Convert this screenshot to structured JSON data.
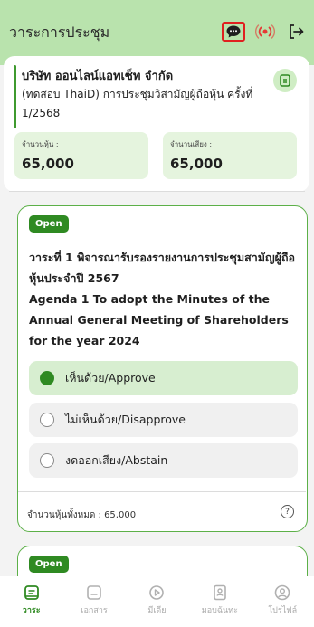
{
  "header": {
    "title": "วาระการประชุม"
  },
  "company": {
    "name": "บริษัท ออนไลน์แอทเซ็ท จำกัด",
    "meeting": "(ทดสอบ ThaiD) การประชุมวิสามัญผู้ถือหุ้น ครั้งที่ 1/2568"
  },
  "stats": {
    "shares_label": "จำนวนหุ้น :",
    "shares_value": "65,000",
    "votes_label": "จำนวนเสียง :",
    "votes_value": "65,000"
  },
  "agenda": {
    "status": "Open",
    "title_th": "วาระที่ 1 พิจารณารับรองรายงานการประชุมสามัญผู้ถือหุ้นประจำปี 2567",
    "title_en": "Agenda 1 To adopt the Minutes of the Annual General Meeting of Shareholders for the year 2024",
    "options": [
      {
        "label": "เห็นด้วย/Approve",
        "selected": true
      },
      {
        "label": "ไม่เห็นด้วย/Disapprove",
        "selected": false
      },
      {
        "label": "งดออกเสียง/Abstain",
        "selected": false
      }
    ],
    "total_label": "จำนวนหุ้นทั้งหมด : 65,000",
    "help_glyph": "?"
  },
  "agenda2": {
    "status": "Open"
  },
  "nav": {
    "items": [
      {
        "label": "วาระ",
        "icon": "agenda-icon",
        "active": true
      },
      {
        "label": "เอกสาร",
        "icon": "document-icon",
        "active": false
      },
      {
        "label": "มีเดีย",
        "icon": "media-icon",
        "active": false
      },
      {
        "label": "มอบฉันทะ",
        "icon": "proxy-icon",
        "active": false
      },
      {
        "label": "โปรไฟล์",
        "icon": "profile-icon",
        "active": false
      }
    ]
  },
  "colors": {
    "primary": "#2f8a22",
    "header_bg": "#b9e3ad",
    "highlight": "#e02020",
    "live": "#e53935"
  }
}
